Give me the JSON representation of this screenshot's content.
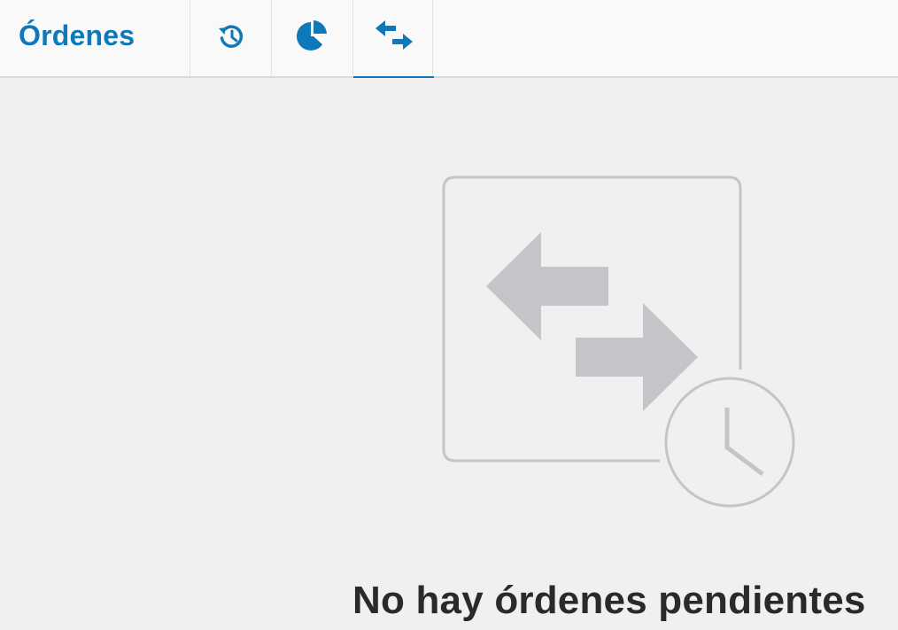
{
  "header": {
    "title": "Órdenes",
    "tabs": [
      {
        "icon": "history-icon",
        "active": false
      },
      {
        "icon": "pie-chart-icon",
        "active": false
      },
      {
        "icon": "transfer-arrows-icon",
        "active": true
      }
    ]
  },
  "empty_state": {
    "icon": "pending-orders-icon",
    "message": "No hay órdenes pendientes"
  },
  "colors": {
    "accent": "#0f78b8",
    "background": "#f0f0f0",
    "header_background": "#f9f9f9",
    "illustration_gray": "#c4c5c8",
    "text_dark": "#2a2a2a"
  }
}
